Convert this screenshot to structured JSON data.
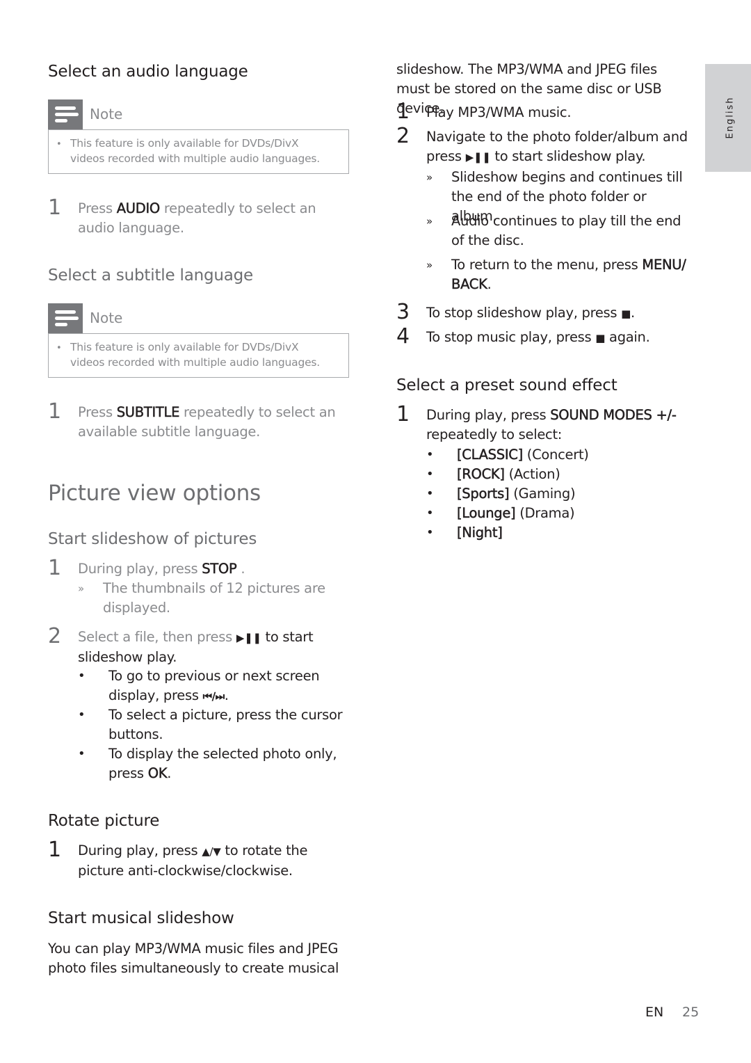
{
  "page": {
    "language_tab": "English",
    "footer_lang": "EN",
    "page_number": "25"
  },
  "left": {
    "audio": {
      "heading": "Select an audio language",
      "note_title": "Note",
      "note_text": "This feature is only available for DVDs/DivX videos recorded with multiple audio languages.",
      "step1": {
        "num": "1",
        "pre": "Press ",
        "key": "AUDIO",
        "post": " repeatedly to select an audio language."
      }
    },
    "subtitle": {
      "heading": "Select a subtitle language",
      "note_title": "Note",
      "note_text": "This feature is only available for DVDs/DivX videos recorded with multiple audio languages.",
      "step1": {
        "num": "1",
        "pre": "Press ",
        "key": "SUBTITLE",
        "post": " repeatedly to select an available subtitle language."
      }
    },
    "picture": {
      "title": "Picture view options",
      "slideshow_heading": "Start slideshow of pictures",
      "step1": {
        "num": "1",
        "pre": "During play, press ",
        "key": "STOP",
        "post": " .",
        "result_icon": "»",
        "result": "The thumbnails of 12 pictures are displayed."
      },
      "step2": {
        "num": "2",
        "pre": "Select a file, then press ",
        "icon": "▶❚❚",
        "post": " to start slideshow play."
      },
      "bullets": [
        {
          "pre": "To go to previous or next screen display, press ",
          "key": "⏮/⏭",
          "post": "."
        },
        {
          "pre": "To select a picture, press the cursor buttons.",
          "key": "",
          "post": ""
        },
        {
          "pre": "To display the selected photo only, press ",
          "key": "OK",
          "post": "."
        }
      ],
      "bullet_glyph": "•"
    },
    "rotate": {
      "heading": "Rotate picture",
      "step1": {
        "num": "1",
        "pre": "During play, press ",
        "key": "▲/▼",
        "post": " to rotate the picture anti-clockwise/clockwise."
      }
    },
    "musical": {
      "heading": "Start musical slideshow",
      "intro": "You can play MP3/WMA music files and JPEG photo files simultaneously to create musical"
    }
  },
  "right": {
    "intro_cont": "slideshow. The MP3/WMA and JPEG files must be stored on the same disc or USB device.",
    "steps": [
      {
        "num": "1",
        "text": "Play MP3/WMA music."
      },
      {
        "num": "2",
        "pre": "Navigate to the photo folder/album and press ",
        "icon": "▶❚❚",
        "post": " to start slideshow play."
      }
    ],
    "results": [
      {
        "icon": "»",
        "text": "Slideshow begins and continues till the end of the photo folder or album."
      },
      {
        "icon": "»",
        "text": "Audio continues to play till the end of the disc."
      },
      {
        "icon": "»",
        "pre": "To return to the menu, press ",
        "key": "MENU/ BACK",
        "post": "."
      }
    ],
    "step3": {
      "num": "3",
      "pre": "To stop slideshow play, press ",
      "icon": "■",
      "post": "."
    },
    "step4": {
      "num": "4",
      "pre": "To stop music play, press ",
      "icon": "■",
      "post": " again."
    },
    "sound": {
      "heading": "Select a preset sound effect",
      "step1": {
        "num": "1",
        "pre": "During play, press ",
        "key": "SOUND MODES +/-",
        "post": " repeatedly to select:"
      },
      "options": [
        {
          "key": "[CLASSIC]",
          "desc": " (Concert)"
        },
        {
          "key": "[ROCK]",
          "desc": " (Action)"
        },
        {
          "key": "[Sports]",
          "desc": " (Gaming)"
        },
        {
          "key": "[Lounge]",
          "desc": " (Drama)"
        },
        {
          "key": "[Night]",
          "desc": ""
        }
      ],
      "bullet_glyph": "•"
    }
  }
}
